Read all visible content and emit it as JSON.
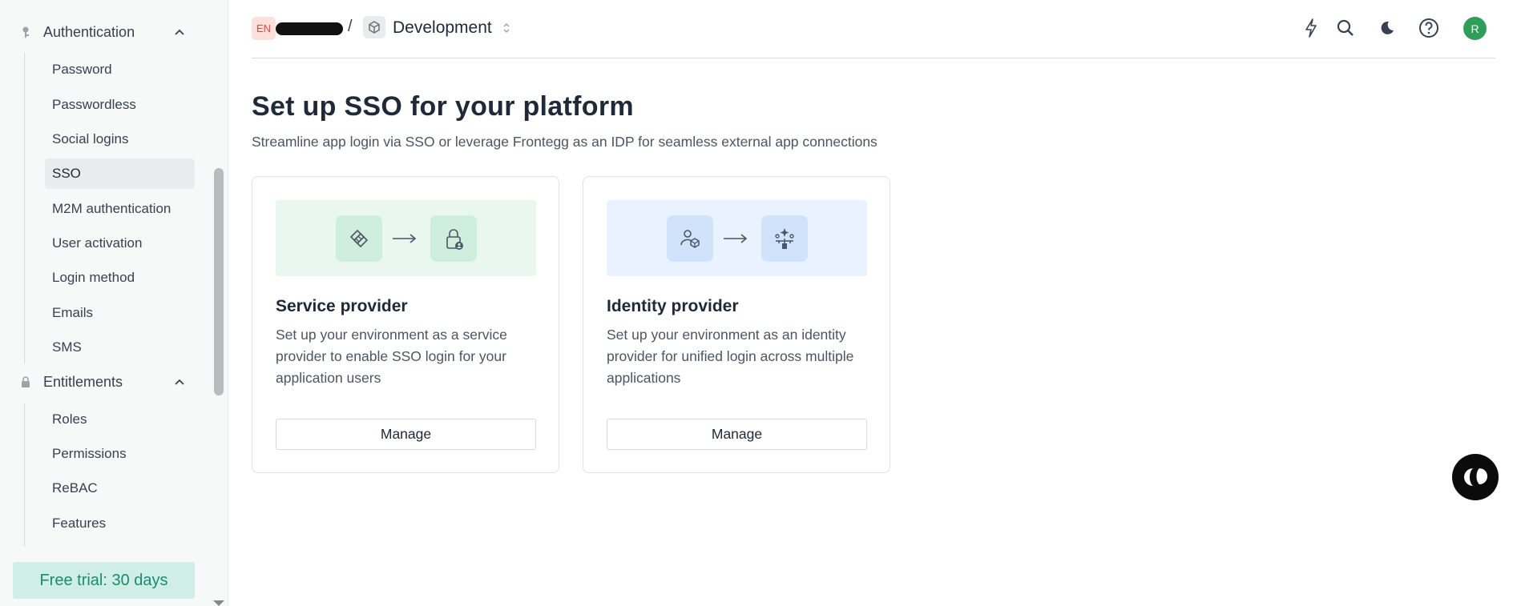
{
  "sidebar": {
    "groups": [
      {
        "label": "Authentication",
        "items": [
          "Password",
          "Passwordless",
          "Social logins",
          "SSO",
          "M2M authentication",
          "User activation",
          "Login method",
          "Emails",
          "SMS"
        ]
      },
      {
        "label": "Entitlements",
        "items": [
          "Roles",
          "Permissions",
          "ReBAC",
          "Features"
        ]
      }
    ],
    "active_item": "SSO",
    "trial_label": "Free trial: 30 days"
  },
  "topbar": {
    "env_badge": "EN",
    "separator": "/",
    "environment": "Development",
    "avatar_initial": "R"
  },
  "main": {
    "title": "Set up SSO for your platform",
    "subtitle": "Streamline app login via SSO or leverage Frontegg as an IDP for seamless external app connections",
    "cards": [
      {
        "title": "Service provider",
        "description": "Set up your environment as a service provider to enable SSO login for your application users",
        "button": "Manage"
      },
      {
        "title": "Identity provider",
        "description": "Set up your environment as an identity provider for unified login across multiple applications",
        "button": "Manage"
      }
    ]
  },
  "colors": {
    "brand_green": "#1d8a72",
    "trial_bg": "#cfeee6",
    "sp_illus_bg": "#e9f7ef",
    "sp_tile": "#cfeedd",
    "idp_illus_bg": "#e9f2fe",
    "idp_tile": "#d0e3fb",
    "avatar": "#2f9e58"
  },
  "icons": [
    "key-icon",
    "lock-icon",
    "chevron-up-icon",
    "cube-icon",
    "updown-chevron-icon",
    "bolt-icon",
    "search-icon",
    "moon-icon",
    "help-icon",
    "handshake-icon",
    "lock-user-icon",
    "user-cube-icon",
    "sparkle-hierarchy-icon",
    "arrow-right-icon",
    "chat-icon"
  ]
}
